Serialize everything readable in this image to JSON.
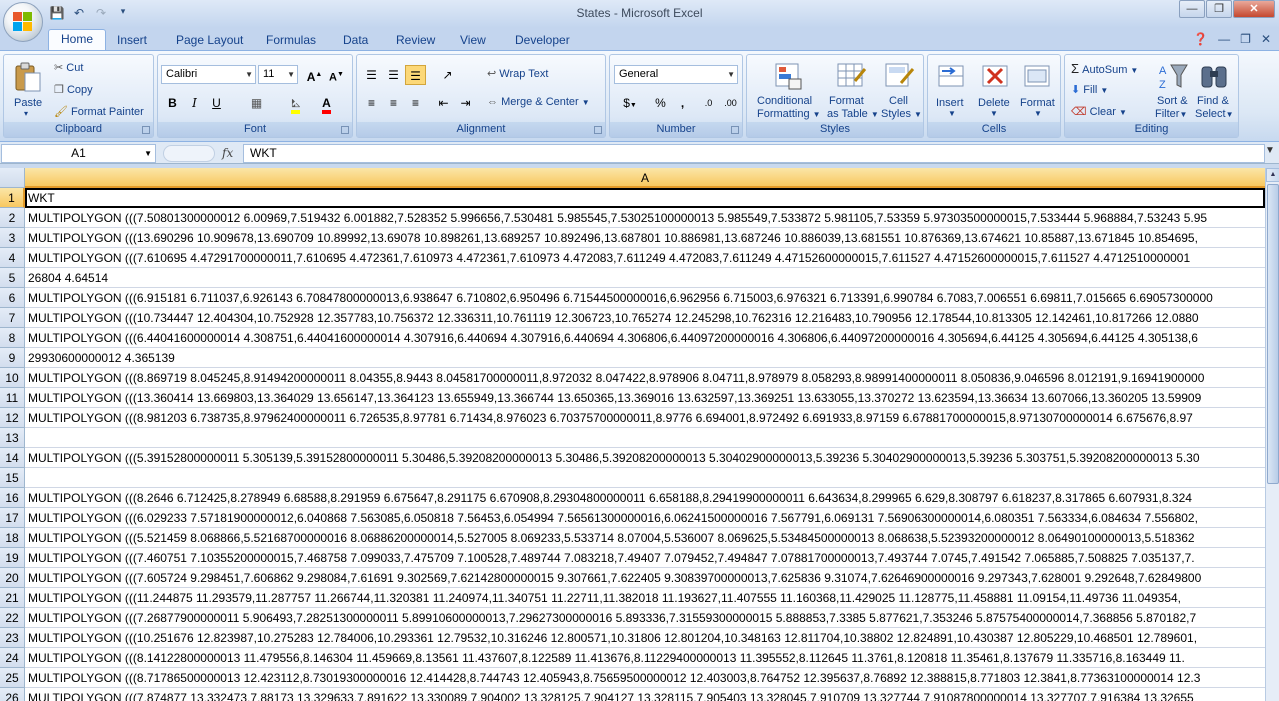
{
  "window": {
    "title": "States - Microsoft Excel"
  },
  "tabs": [
    "Home",
    "Insert",
    "Page Layout",
    "Formulas",
    "Data",
    "Review",
    "View",
    "Developer"
  ],
  "clipboard": {
    "paste": "Paste",
    "cut": "Cut",
    "copy": "Copy",
    "format_painter": "Format Painter",
    "label": "Clipboard"
  },
  "font": {
    "name": "Calibri",
    "size": "11",
    "bold": "B",
    "italic": "I",
    "underline": "U",
    "label": "Font"
  },
  "alignment": {
    "wrap_text": "Wrap Text",
    "merge_center": "Merge & Center",
    "label": "Alignment"
  },
  "number": {
    "format": "General",
    "currency": "$",
    "percent": "%",
    "comma": ",",
    "inc_decimal": ".0",
    "dec_decimal": ".00",
    "label": "Number"
  },
  "styles": {
    "conditional_formatting": "Conditional",
    "conditional_formatting2": "Formatting",
    "format_as_table": "Format",
    "format_as_table2": "as Table",
    "cell_styles": "Cell",
    "cell_styles2": "Styles",
    "label": "Styles"
  },
  "cells": {
    "insert": "Insert",
    "delete": "Delete",
    "format": "Format",
    "label": "Cells"
  },
  "editing": {
    "autosum": "AutoSum",
    "fill": "Fill",
    "clear": "Clear",
    "sort_filter": "Sort &",
    "sort_filter2": "Filter",
    "find_select": "Find &",
    "find_select2": "Select",
    "label": "Editing"
  },
  "formula_bar": {
    "name_box": "A1",
    "fx": "fx",
    "content": "WKT"
  },
  "sheet": {
    "column": "A",
    "rows": [
      {
        "num": "1",
        "text": "WKT"
      },
      {
        "num": "2",
        "text": "MULTIPOLYGON (((7.50801300000012 6.00969,7.519432 6.001882,7.528352 5.996656,7.530481 5.985545,7.53025100000013 5.985549,7.533872 5.981105,7.53359 5.97303500000015,7.533444 5.968884,7.53243 5.95"
      },
      {
        "num": "3",
        "text": "MULTIPOLYGON (((13.690296 10.909678,13.690709 10.89992,13.69078 10.898261,13.689257 10.892496,13.687801 10.886981,13.687246 10.886039,13.681551 10.876369,13.674621 10.85887,13.671845 10.854695,"
      },
      {
        "num": "4",
        "text": "MULTIPOLYGON (((7.610695 4.47291700000011,7.610695 4.472361,7.610973 4.472361,7.610973 4.472083,7.611249 4.472083,7.611249 4.47152600000015,7.611527 4.47152600000015,7.611527 4.4712510000001"
      },
      {
        "num": "5",
        "text": "26804 4.64514"
      },
      {
        "num": "6",
        "text": "MULTIPOLYGON (((6.915181 6.711037,6.926143 6.70847800000013,6.938647 6.710802,6.950496 6.71544500000016,6.962956 6.715003,6.976321 6.713391,6.990784 6.7083,7.006551 6.69811,7.015665 6.69057300000"
      },
      {
        "num": "7",
        "text": "MULTIPOLYGON (((10.734447 12.404304,10.752928 12.357783,10.756372 12.336311,10.761119 12.306723,10.765274 12.245298,10.762316 12.216483,10.790956 12.178544,10.813305 12.142461,10.817266 12.0880"
      },
      {
        "num": "8",
        "text": "MULTIPOLYGON (((6.44041600000014 4.308751,6.44041600000014 4.307916,6.440694 4.307916,6.440694 4.306806,6.44097200000016 4.306806,6.44097200000016 4.305694,6.44125 4.305694,6.44125 4.305138,6"
      },
      {
        "num": "9",
        "text": "29930600000012 4.365139"
      },
      {
        "num": "10",
        "text": "MULTIPOLYGON (((8.869719 8.045245,8.91494200000011 8.04355,8.9443 8.04581700000011,8.972032 8.047422,8.978906 8.04711,8.978979 8.058293,8.98991400000011 8.050836,9.046596 8.012191,9.16941900000"
      },
      {
        "num": "11",
        "text": "MULTIPOLYGON (((13.360414 13.669803,13.364029 13.656147,13.364123 13.655949,13.366744 13.650365,13.369016 13.632597,13.369251 13.633055,13.370272 13.623594,13.36634 13.607066,13.360205 13.59909"
      },
      {
        "num": "12",
        "text": "MULTIPOLYGON (((8.981203 6.738735,8.97962400000011 6.726535,8.97781 6.71434,8.976023 6.70375700000011,8.9776 6.694001,8.972492 6.691933,8.97159 6.67881700000015,8.97130700000014 6.675676,8.97"
      },
      {
        "num": "13",
        "text": ""
      },
      {
        "num": "14",
        "text": "MULTIPOLYGON (((5.39152800000011 5.305139,5.39152800000011 5.30486,5.39208200000013 5.30486,5.39208200000013 5.30402900000013,5.39236 5.30402900000013,5.39236 5.303751,5.39208200000013 5.30"
      },
      {
        "num": "15",
        "text": ""
      },
      {
        "num": "16",
        "text": "MULTIPOLYGON (((8.2646 6.712425,8.278949 6.68588,8.291959 6.675647,8.291175 6.670908,8.29304800000011 6.658188,8.29419900000011 6.643634,8.299965 6.629,8.308797 6.618237,8.317865 6.607931,8.324"
      },
      {
        "num": "17",
        "text": "MULTIPOLYGON (((6.029233 7.57181900000012,6.040868 7.563085,6.050818 7.56453,6.054994 7.56561300000016,6.06241500000016 7.567791,6.069131 7.56906300000014,6.080351 7.563334,6.084634 7.556802,"
      },
      {
        "num": "18",
        "text": "MULTIPOLYGON (((5.521459 8.068866,5.52168700000016 8.06886200000014,5.527005 8.069233,5.533714 8.07004,5.536007 8.069625,5.53484500000013 8.068638,5.52393200000012 8.06490100000013,5.518362"
      },
      {
        "num": "19",
        "text": "MULTIPOLYGON (((7.460751 7.10355200000015,7.468758 7.099033,7.475709 7.100528,7.489744 7.083218,7.49407 7.079452,7.494847 7.07881700000013,7.493744 7.0745,7.491542 7.065885,7.508825 7.035137,7."
      },
      {
        "num": "20",
        "text": "MULTIPOLYGON (((7.605724 9.298451,7.606862 9.298084,7.61691 9.302569,7.62142800000015 9.307661,7.622405 9.30839700000013,7.625836 9.31074,7.62646900000016 9.297343,7.628001 9.292648,7.62849800"
      },
      {
        "num": "21",
        "text": "MULTIPOLYGON (((11.244875 11.293579,11.287757 11.266744,11.320381 11.240974,11.340751 11.22711,11.382018 11.193627,11.407555 11.160368,11.429025 11.128775,11.458881 11.09154,11.49736 11.049354,"
      },
      {
        "num": "22",
        "text": "MULTIPOLYGON (((7.26877900000011 5.906493,7.28251300000011 5.89910600000013,7.29627300000016 5.893336,7.31559300000015 5.888853,7.3385 5.877621,7.353246 5.87575400000014,7.368856 5.870182,7"
      },
      {
        "num": "23",
        "text": "MULTIPOLYGON (((10.251676 12.823987,10.275283 12.784006,10.293361 12.79532,10.316246 12.800571,10.31806 12.801204,10.348163 12.811704,10.38802 12.824891,10.430387 12.805229,10.468501 12.789601,"
      },
      {
        "num": "24",
        "text": "MULTIPOLYGON (((8.14122800000013 11.479556,8.146304 11.459669,8.13561 11.437607,8.122589 11.413676,8.11229400000013 11.395552,8.112645 11.3761,8.120818 11.35461,8.137679 11.335716,8.163449 11."
      },
      {
        "num": "25",
        "text": "MULTIPOLYGON (((8.71786500000013 12.423112,8.73019300000016 12.414428,8.744743 12.405943,8.75659500000012 12.403003,8.764752 12.395637,8.76892 12.388815,8.771803 12.3841,8.77363100000014 12.3"
      },
      {
        "num": "26",
        "text": "MULTIPOLYGON (((7.874877 13.332473,7.88173 13.329633,7.891622 13.330089,7.904002 13.328125,7.904127 13.328115,7.905403 13.328045,7.910709 13.327744,7.91087800000014 13.327707,7.916384 13.32655"
      }
    ]
  }
}
